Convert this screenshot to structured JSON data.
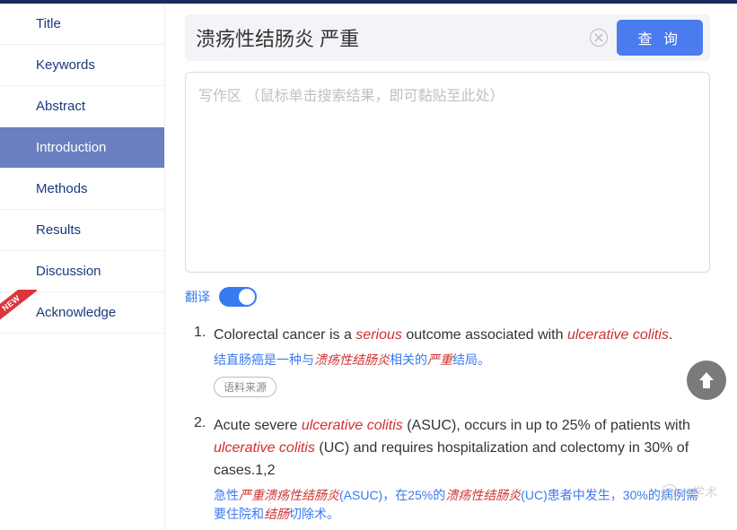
{
  "sidebar": {
    "items": [
      {
        "label": "Title",
        "active": false,
        "new": false
      },
      {
        "label": "Keywords",
        "active": false,
        "new": false
      },
      {
        "label": "Abstract",
        "active": false,
        "new": false
      },
      {
        "label": "Introduction",
        "active": true,
        "new": false
      },
      {
        "label": "Methods",
        "active": false,
        "new": false
      },
      {
        "label": "Results",
        "active": false,
        "new": false
      },
      {
        "label": "Discussion",
        "active": false,
        "new": false
      },
      {
        "label": "Acknowledge",
        "active": false,
        "new": true
      }
    ]
  },
  "search": {
    "value": "溃疡性结肠炎 严重",
    "button": "查 询"
  },
  "editor": {
    "placeholder": "写作区 （鼠标单击搜索结果，即可黏贴至此处）"
  },
  "translate": {
    "label": "翻译",
    "on": true
  },
  "results": [
    {
      "num": "1.",
      "en_parts": [
        {
          "t": "Colorectal cancer is a ",
          "hl": false
        },
        {
          "t": "serious",
          "hl": true
        },
        {
          "t": " outcome associated with ",
          "hl": false
        },
        {
          "t": "ulcerative colitis",
          "hl": true
        },
        {
          "t": ".",
          "hl": false
        }
      ],
      "zh_parts": [
        {
          "t": "结直肠癌是一种与",
          "hl": false
        },
        {
          "t": "溃疡性结肠炎",
          "hl": true
        },
        {
          "t": "相关的",
          "hl": false
        },
        {
          "t": "严重",
          "hl": true
        },
        {
          "t": "结局。",
          "hl": false
        }
      ],
      "source_btn": "语料来源"
    },
    {
      "num": "2.",
      "en_parts": [
        {
          "t": "Acute severe ",
          "hl": false
        },
        {
          "t": "ulcerative colitis",
          "hl": true
        },
        {
          "t": " (ASUC), occurs in up to 25% of patients with ",
          "hl": false
        },
        {
          "t": "ulcerative colitis",
          "hl": true
        },
        {
          "t": " (UC) and requires hospitalization and colectomy in 30% of cases.1,2",
          "hl": false
        }
      ],
      "zh_parts": [
        {
          "t": "急性",
          "hl": false
        },
        {
          "t": "严重溃疡性结肠炎",
          "hl": true
        },
        {
          "t": "(ASUC)，在25%的",
          "hl": false
        },
        {
          "t": "溃疡性结肠炎",
          "hl": true
        },
        {
          "t": "(UC)患者中发生，30%的病例需要住院和",
          "hl": false
        },
        {
          "t": "结肠",
          "hl": true
        },
        {
          "t": "切除术。",
          "hl": false
        }
      ]
    }
  ],
  "watermark": "AI学术"
}
